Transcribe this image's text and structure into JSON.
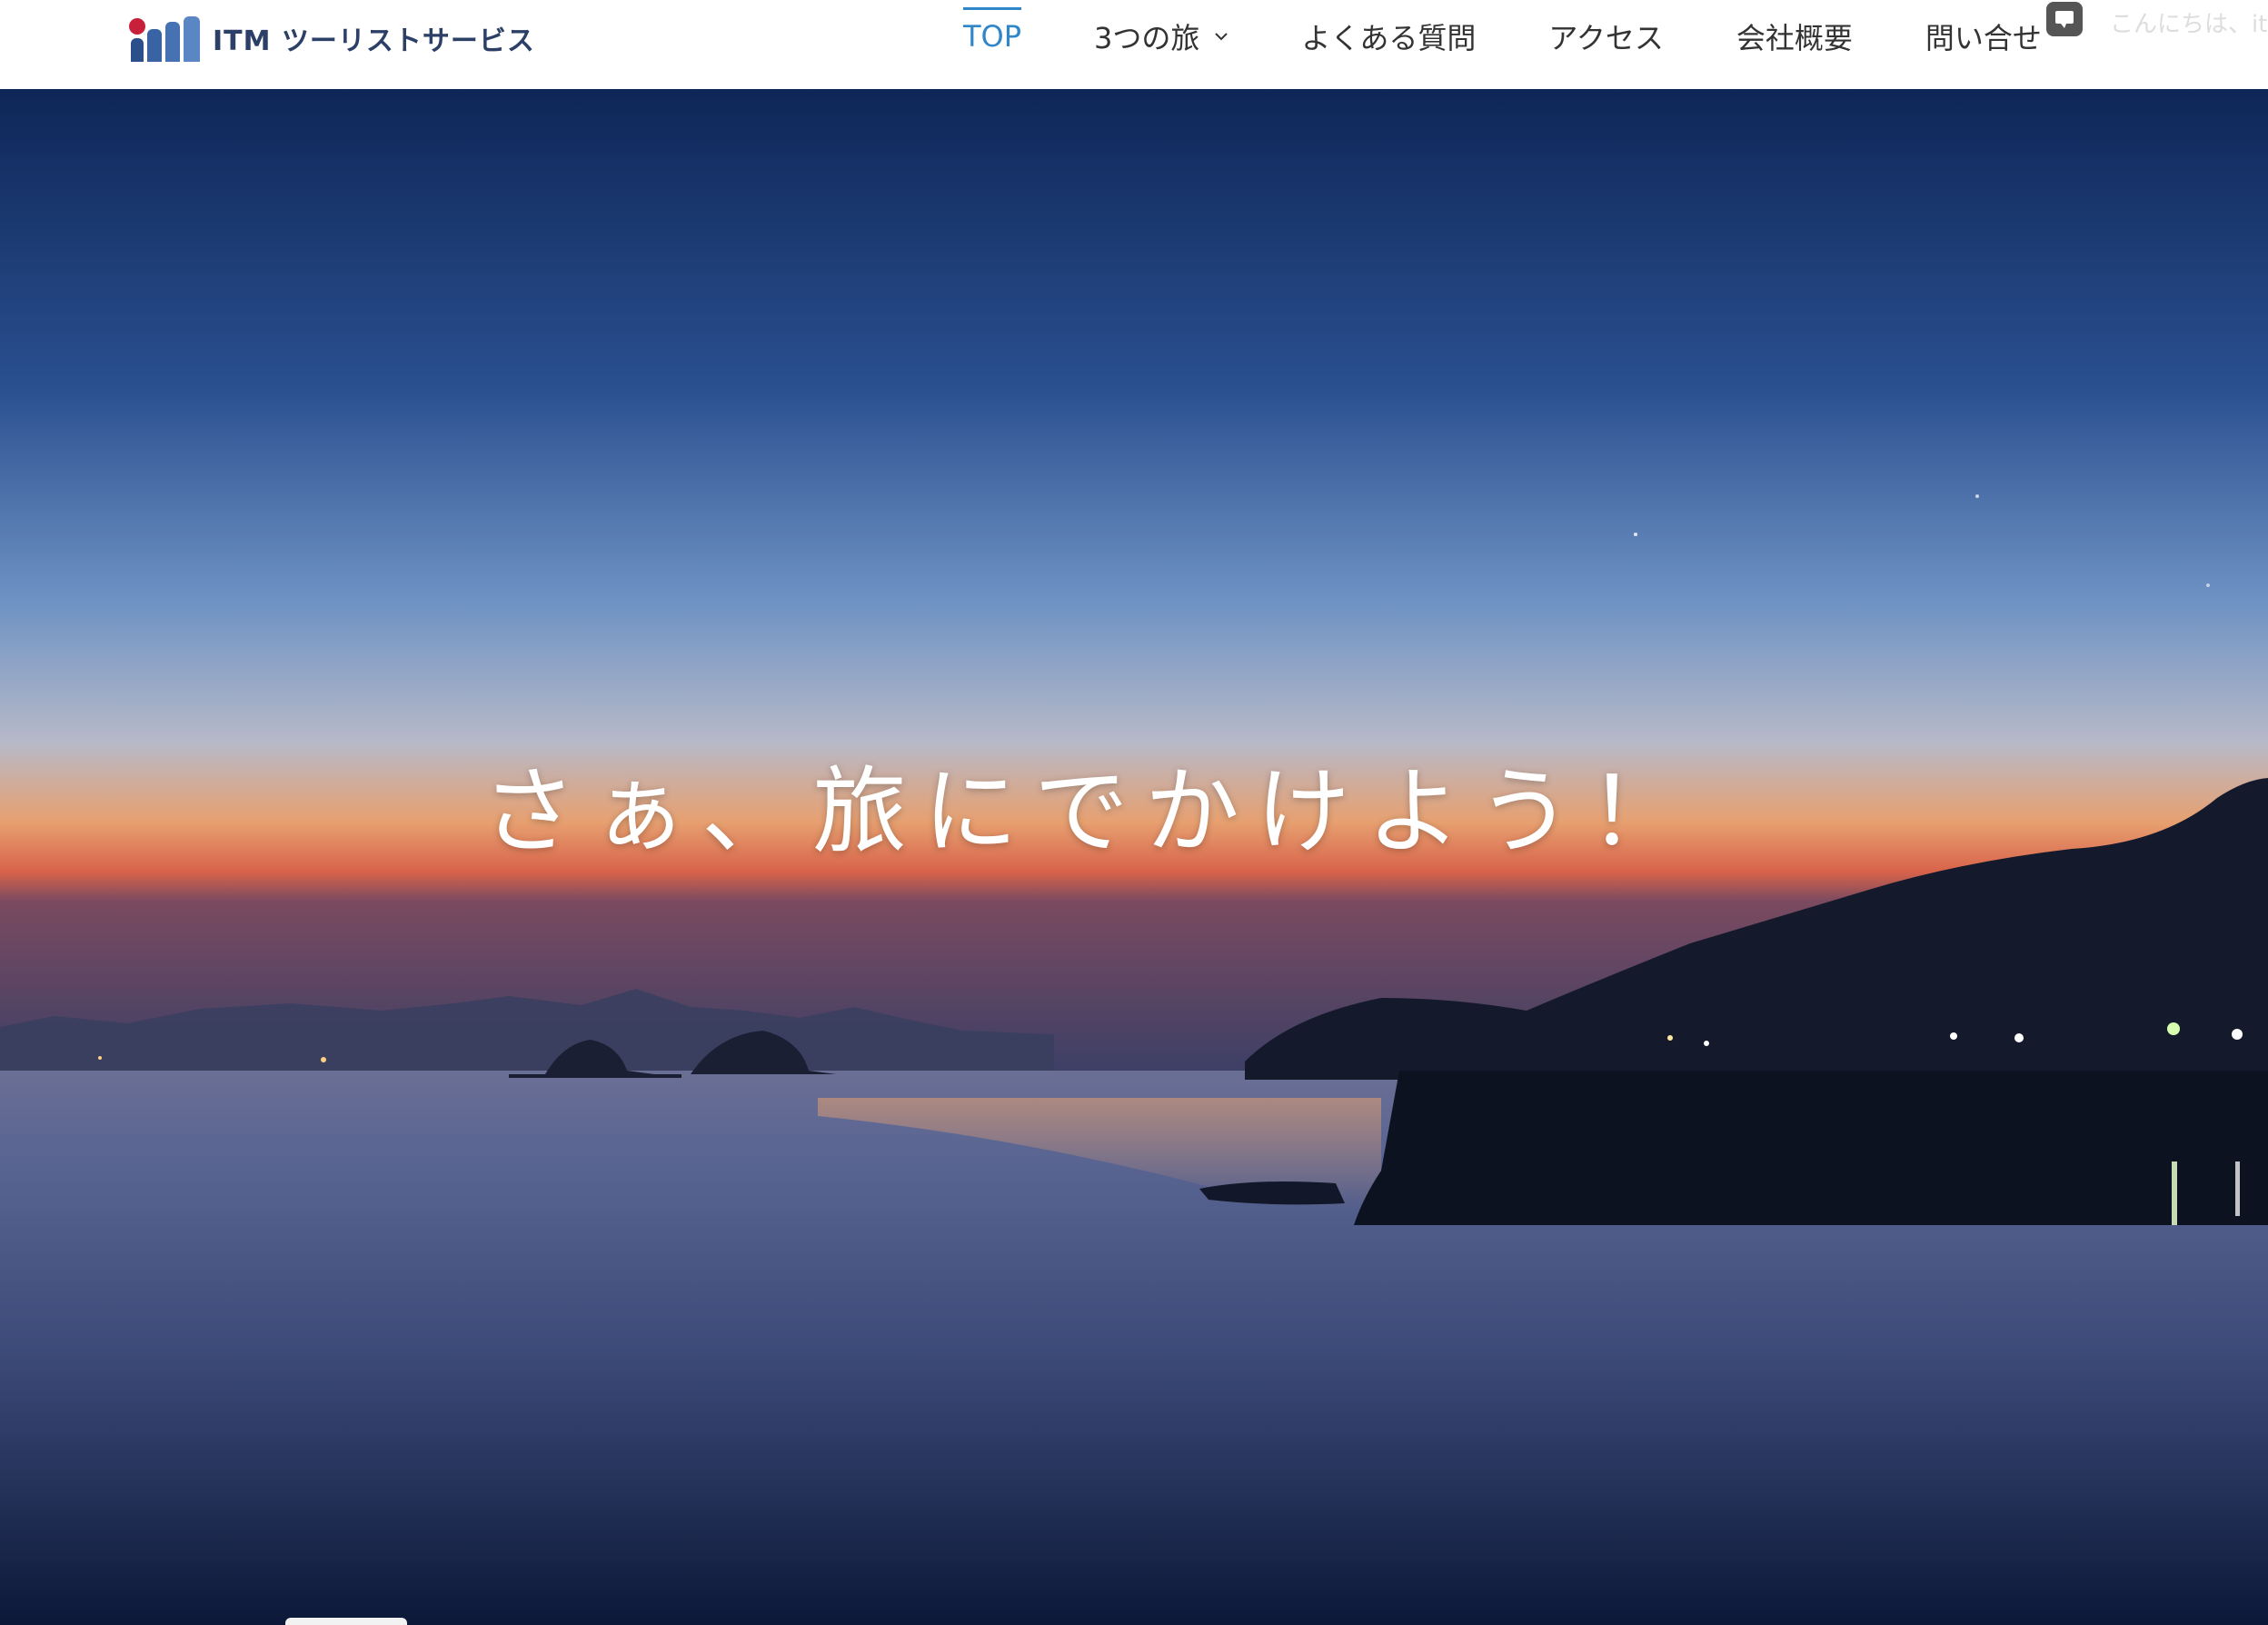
{
  "brand": {
    "name": "ITM ツーリストサービス",
    "colors": {
      "red": "#c8203a",
      "navy": "#2a4f8a",
      "accent": "#2f86c8"
    }
  },
  "nav": {
    "items": [
      {
        "label": "TOP",
        "active": true
      },
      {
        "label": "3つの旅",
        "has_dropdown": true
      },
      {
        "label": "よくある質問"
      },
      {
        "label": "アクセス"
      },
      {
        "label": "会社概要"
      },
      {
        "label": "問い合せ"
      }
    ]
  },
  "chat": {
    "icon": "chat-bubble-icon",
    "greeting": "こんにちは、it"
  },
  "hero": {
    "title": "さぁ、旅にでかけよう！"
  }
}
